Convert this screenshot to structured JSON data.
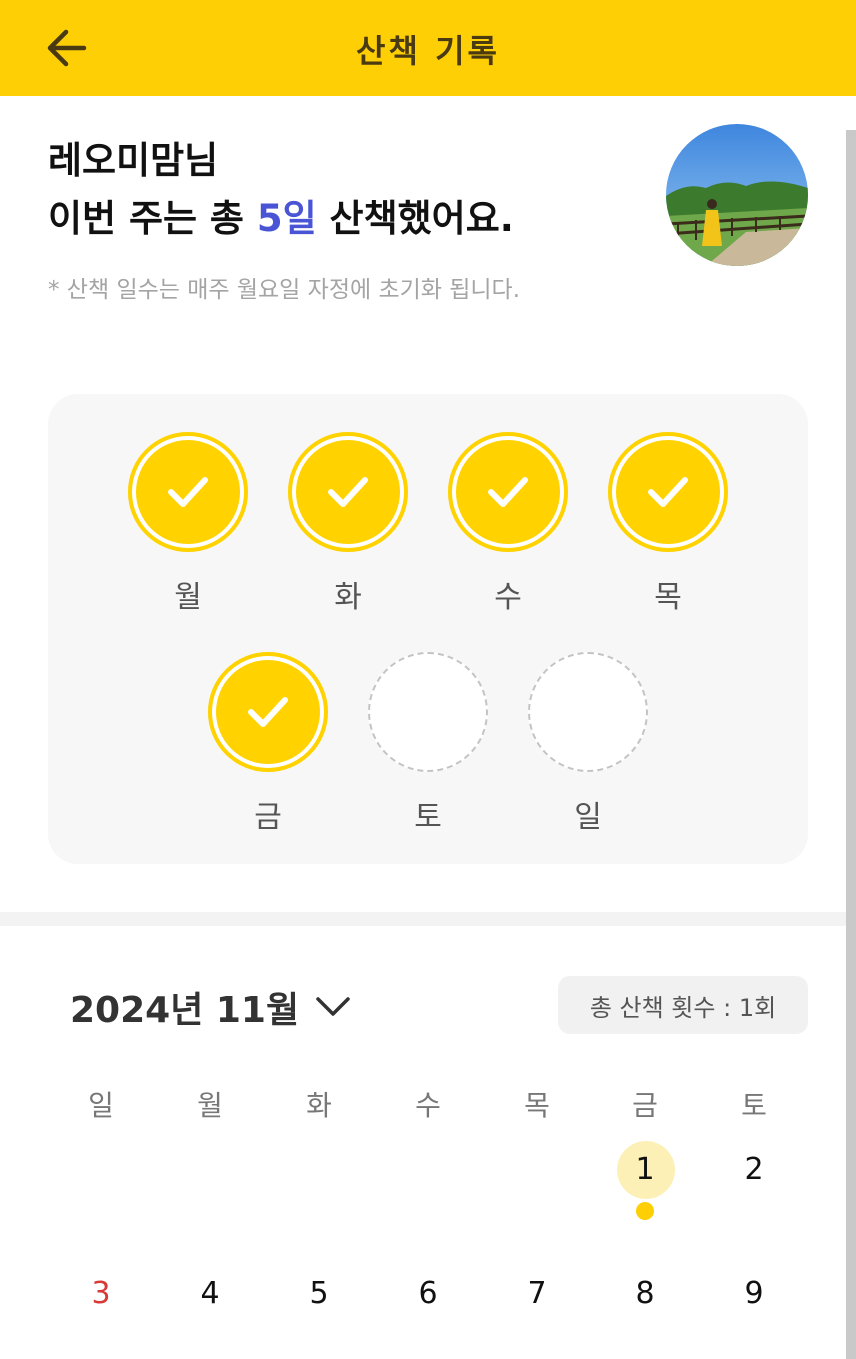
{
  "header": {
    "title": "산책 기록"
  },
  "summary": {
    "greeting_name": "레오미맘님",
    "line2_prefix": "이번 주는 총 ",
    "days_walked": "5일",
    "line2_suffix": " 산책했어요.",
    "reset_note": "* 산책 일수는 매주 월요일 자정에 초기화 됩니다."
  },
  "week": {
    "days": [
      {
        "label": "월",
        "done": true
      },
      {
        "label": "화",
        "done": true
      },
      {
        "label": "수",
        "done": true
      },
      {
        "label": "목",
        "done": true
      },
      {
        "label": "금",
        "done": true
      },
      {
        "label": "토",
        "done": false
      },
      {
        "label": "일",
        "done": false
      }
    ]
  },
  "calendar": {
    "month_label": "2024년 11월",
    "total_walks": "총 산책 횟수 : 1회",
    "weekday_headers": [
      "일",
      "월",
      "화",
      "수",
      "목",
      "금",
      "토"
    ],
    "dates_row1": [
      "1",
      "2"
    ],
    "dates_row2": [
      "3",
      "4",
      "5",
      "6",
      "7",
      "8",
      "9"
    ],
    "today": "1",
    "walk_dates": [
      "1"
    ]
  },
  "colors": {
    "brand_yellow": "#FFCF06",
    "highlight_blue": "#4A55D6",
    "sunday_red": "#D83A3A"
  },
  "icons": [
    "back-arrow-icon",
    "check-icon",
    "chevron-down-icon"
  ]
}
